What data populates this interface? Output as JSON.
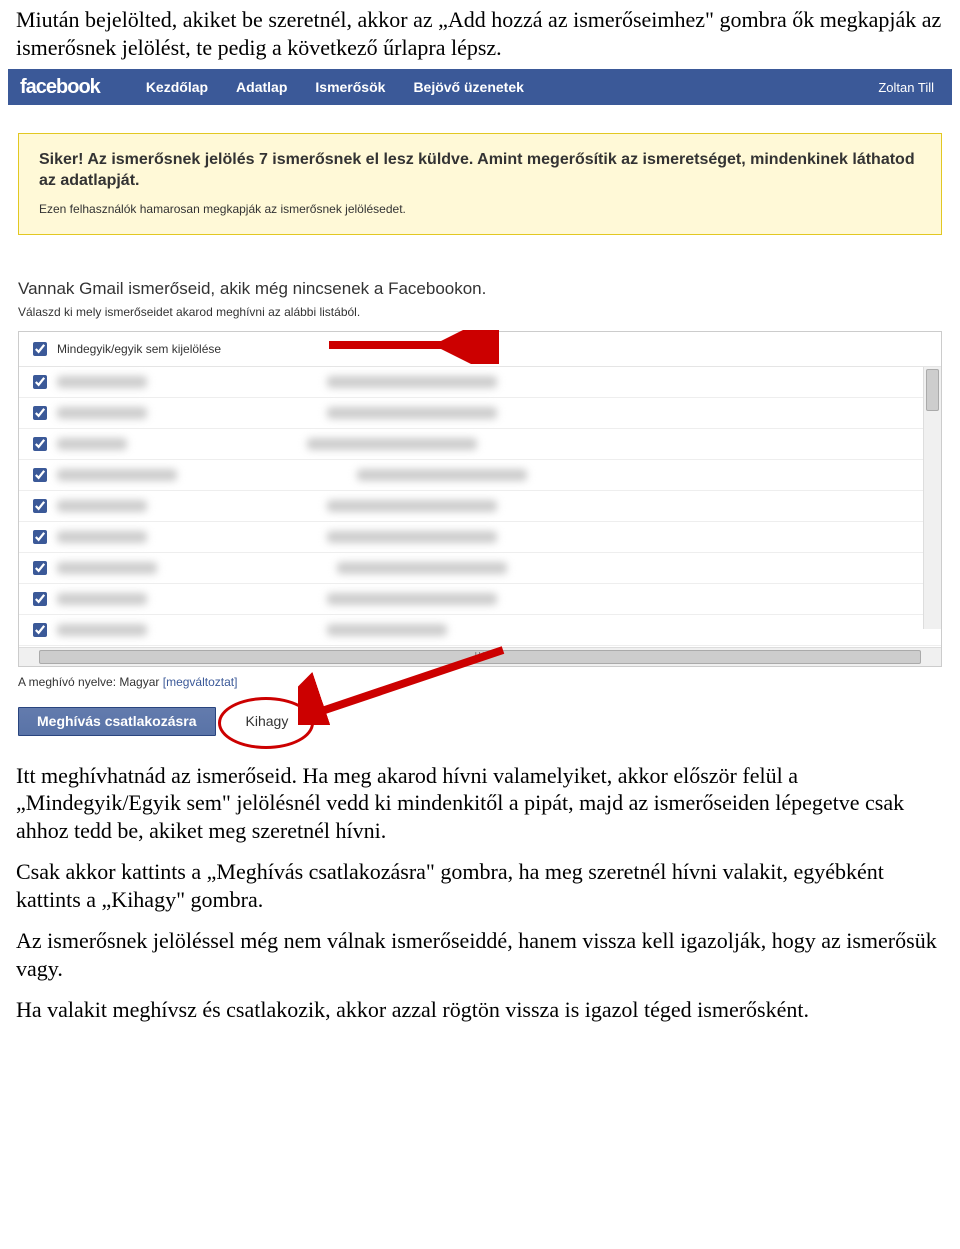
{
  "doc": {
    "p1": "Miután bejelölted, akiket be szeretnél, akkor az „Add hozzá az ismerőseimhez\" gombra ők megkapják az ismerősnek jelölést, te pedig a következő űrlapra lépsz.",
    "p2": "Itt meghívhatnád az ismerőseid. Ha meg akarod hívni valamelyiket, akkor először felül a „Mindegyik/Egyik sem\" jelölésnél vedd ki mindenkitől a pipát, majd az ismerőseiden lépegetve csak ahhoz tedd be, akiket meg szeretnél hívni.",
    "p3": "Csak akkor kattints a „Meghívás csatlakozásra\" gombra, ha meg szeretnél hívni valakit, egyébként kattints a „Kihagy\" gombra.",
    "p4": "Az ismerősnek jelöléssel még nem válnak ismerőseiddé, hanem vissza kell igazolják, hogy az ismerősük vagy.",
    "p5": "Ha valakit meghívsz és csatlakozik, akkor azzal rögtön vissza is igazol téged ismerősként."
  },
  "topbar": {
    "logo": "facebook",
    "nav": {
      "home": "Kezdőlap",
      "profile": "Adatlap",
      "friends": "Ismerősök",
      "inbox": "Bejövő üzenetek"
    },
    "user": "Zoltan Till"
  },
  "success": {
    "title": "Siker! Az ismerősnek jelölés 7 ismerősnek el lesz küldve. Amint megerősítik az ismeretséget, mindenkinek láthatod az adatlapját.",
    "sub": "Ezen felhasználók hamarosan megkapják az ismerősnek jelölésedet."
  },
  "section": {
    "heading": "Vannak Gmail ismerőseid, akik még nincsenek a Facebookon.",
    "sub": "Válaszd ki mely ismerőseidet akarod meghívni az alábbi listából."
  },
  "list": {
    "select_all": "Mindegyik/egyik sem kijelölése"
  },
  "lang": {
    "prefix": "A meghívó nyelve: Magyar ",
    "change": "[megváltoztat]"
  },
  "buttons": {
    "invite": "Meghívás csatlakozásra",
    "skip": "Kihagy"
  }
}
